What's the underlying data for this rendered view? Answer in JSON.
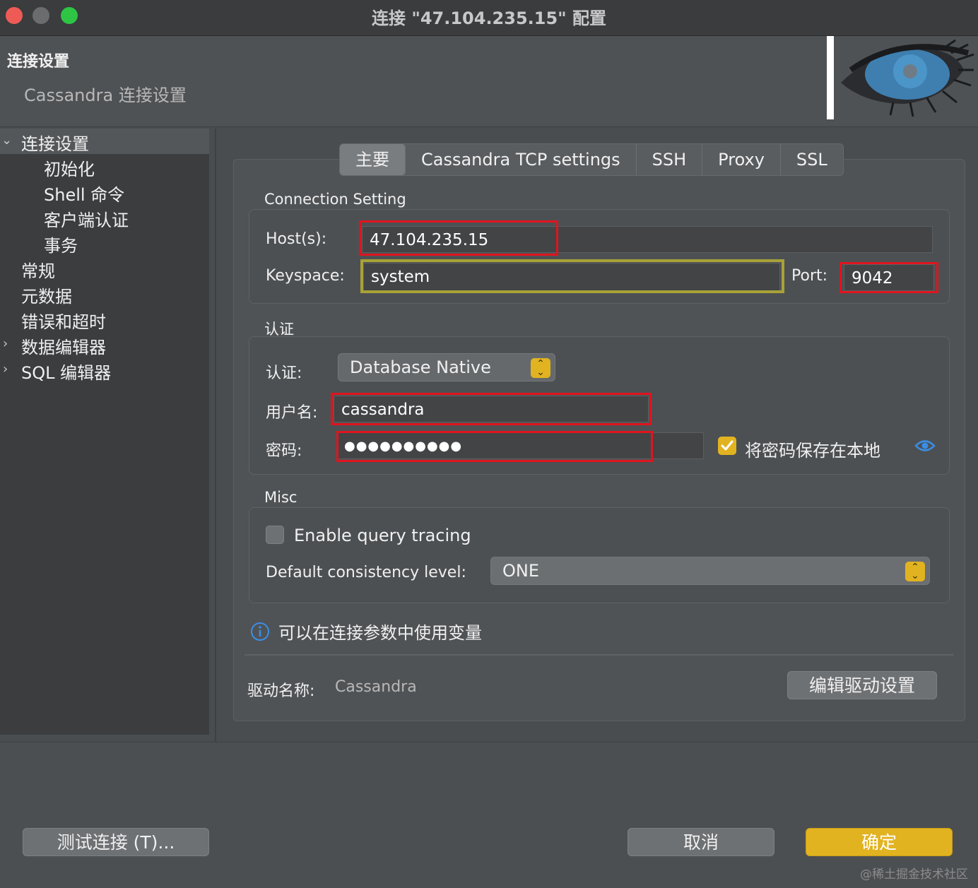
{
  "window": {
    "title": "连接 \"47.104.235.15\" 配置"
  },
  "header": {
    "title": "连接设置",
    "subtitle": "Cassandra 连接设置"
  },
  "sidebar": {
    "items": [
      {
        "label": "连接设置",
        "expanded": true,
        "selected": true
      },
      {
        "label": "初始化"
      },
      {
        "label": "Shell 命令"
      },
      {
        "label": "客户端认证"
      },
      {
        "label": "事务"
      },
      {
        "label": "常规"
      },
      {
        "label": "元数据"
      },
      {
        "label": "错误和超时"
      },
      {
        "label": "数据编辑器",
        "collapsed": true
      },
      {
        "label": "SQL 编辑器",
        "collapsed": true
      }
    ]
  },
  "tabs": [
    {
      "label": "主要",
      "active": true
    },
    {
      "label": "Cassandra TCP settings"
    },
    {
      "label": "SSH"
    },
    {
      "label": "Proxy"
    },
    {
      "label": "SSL"
    }
  ],
  "connection": {
    "section_label": "Connection Setting",
    "host_label": "Host(s):",
    "host_value": "47.104.235.15",
    "keyspace_label": "Keyspace:",
    "keyspace_value": "system",
    "port_label": "Port:",
    "port_value": "9042"
  },
  "auth": {
    "section_label": "认证",
    "auth_label": "认证:",
    "auth_value": "Database Native",
    "username_label": "用户名:",
    "username_value": "cassandra",
    "password_label": "密码:",
    "password_value": "●●●●●●●●●●",
    "save_password_label": "将密码保存在本地",
    "save_password_checked": true
  },
  "misc": {
    "section_label": "Misc",
    "tracing_label": "Enable query tracing",
    "tracing_checked": false,
    "consistency_label": "Default consistency level:",
    "consistency_value": "ONE"
  },
  "info": {
    "text": "可以在连接参数中使用变量"
  },
  "driver": {
    "label": "驱动名称:",
    "value": "Cassandra",
    "edit_button": "编辑驱动设置"
  },
  "footer": {
    "test_button": "测试连接 (T)...",
    "cancel_button": "取消",
    "ok_button": "确定"
  },
  "watermark": "@稀土掘金技术社区",
  "colors": {
    "accent": "#e2b321",
    "highlight_red": "#e0141e",
    "highlight_olive": "#a8a238",
    "info_blue": "#3a8ee6"
  }
}
